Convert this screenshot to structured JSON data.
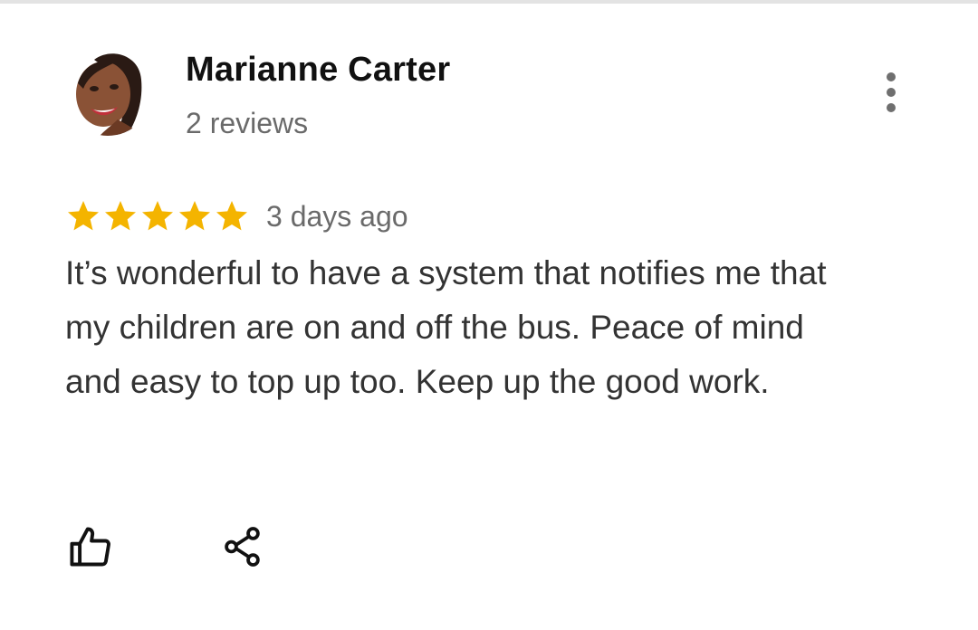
{
  "review": {
    "author_name": "Marianne Carter",
    "review_count": "2 reviews",
    "rating": 5,
    "rating_max": 5,
    "date": "3 days ago",
    "text": "It’s wonderful to have a system that notifies me that my children are on and off the bus. Peace of mind and easy to top up too. Keep up the good work."
  },
  "colors": {
    "star": "#F4B400",
    "name": "#111111",
    "secondary_text": "#6A6A6A",
    "body_text": "#333333",
    "icon": "#111111",
    "divider": "#E3E3E3"
  },
  "icons": {
    "more": "more-vert-icon",
    "like": "thumbs-up-icon",
    "share": "share-icon"
  }
}
